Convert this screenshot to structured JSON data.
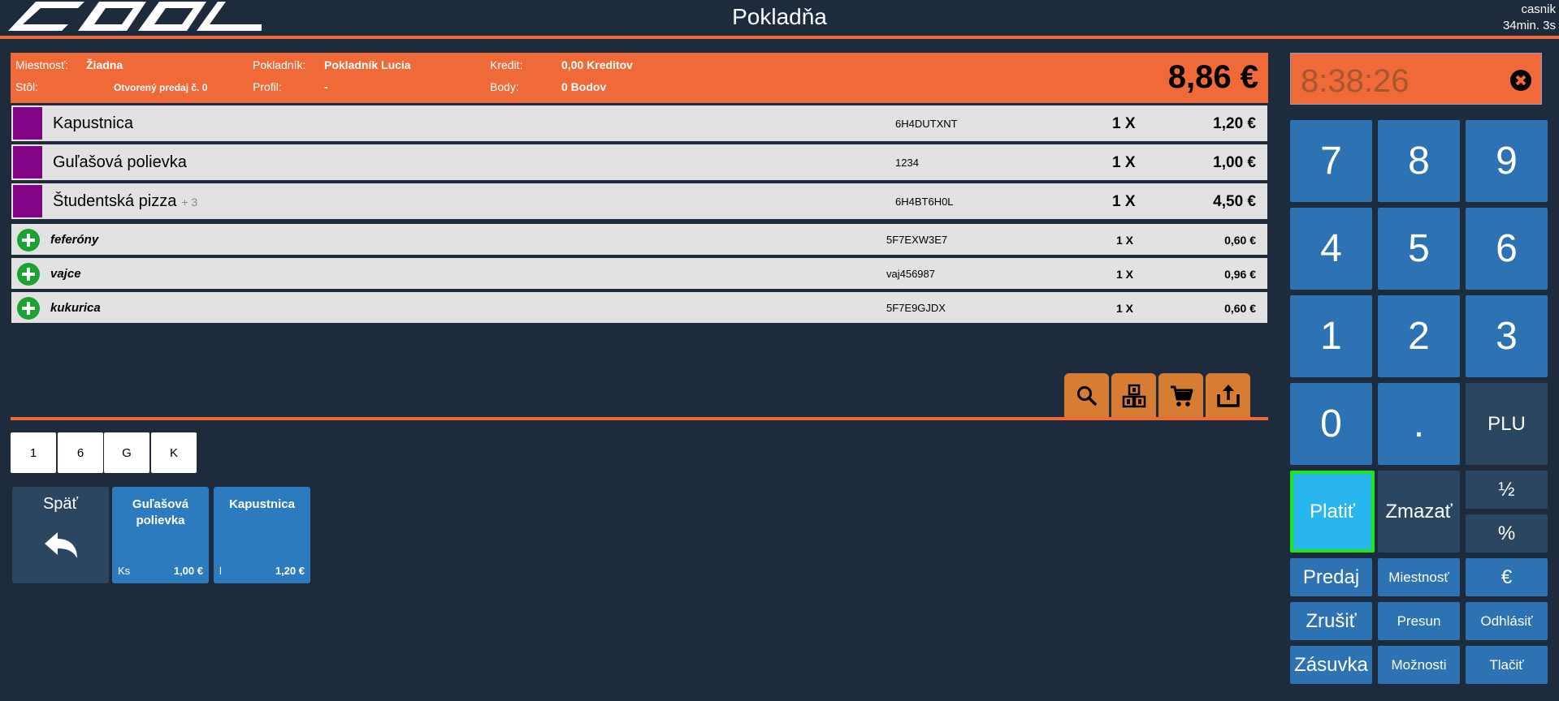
{
  "header": {
    "title": "Pokladňa",
    "user": "casnik",
    "session_time": "34min. 3s"
  },
  "info": {
    "room_label": "Miestnosť:",
    "room_value": "Žiadna",
    "table_label": "Stôl:",
    "table_value": "Otvorený predaj č. 0",
    "cashier_label": "Pokladník:",
    "cashier_value": "Pokladník Lucia",
    "profile_label": "Profil:",
    "profile_value": "-",
    "credit_label": "Kredit:",
    "credit_value": "0,00 Kreditov",
    "points_label": "Body:",
    "points_value": "0 Bodov",
    "total": "8,86 €"
  },
  "order": {
    "items": [
      {
        "name": "Kapustnica",
        "extra": "",
        "code": "6H4DUTXNT",
        "qty": "1 X",
        "price": "1,20 €"
      },
      {
        "name": "Guľašová polievka",
        "extra": "",
        "code": "1234",
        "qty": "1 X",
        "price": "1,00 €"
      },
      {
        "name": "Študentská pizza",
        "extra": "+ 3",
        "code": "6H4BT6H0L",
        "qty": "1 X",
        "price": "4,50 €"
      }
    ],
    "addons": [
      {
        "name": "feferóny",
        "code": "5F7EXW3E7",
        "qty": "1 X",
        "price": "0,60 €"
      },
      {
        "name": "vajce",
        "code": "vaj456987",
        "qty": "1 X",
        "price": "0,96 €"
      },
      {
        "name": "kukurica",
        "code": "5F7E9GJDX",
        "qty": "1 X",
        "price": "0,60 €"
      }
    ]
  },
  "toolbar": {
    "icons": [
      "search-icon",
      "product-codes-icon",
      "cart-icon",
      "export-icon"
    ]
  },
  "filters": [
    "1",
    "6",
    "G",
    "K"
  ],
  "tiles": {
    "back_label": "Späť",
    "products": [
      {
        "name": "Guľašová polievka",
        "unit": "Ks",
        "price": "1,00 €"
      },
      {
        "name": "Kapustnica",
        "unit": "l",
        "price": "1,20 €"
      }
    ]
  },
  "display": {
    "value": "8:38:26"
  },
  "keypad": {
    "k7": "7",
    "k8": "8",
    "k9": "9",
    "k4": "4",
    "k5": "5",
    "k6": "6",
    "k1": "1",
    "k2": "2",
    "k3": "3",
    "k0": "0",
    "dot": ".",
    "plu": "PLU",
    "pay": "Platiť",
    "delete": "Zmazať",
    "half": "½",
    "percent": "%",
    "sale": "Predaj",
    "room": "Miestnosť",
    "euro": "€",
    "cancel": "Zrušiť",
    "move": "Presun",
    "logout": "Odhlásiť",
    "drawer": "Zásuvka",
    "options": "Možnosti",
    "print": "Tlačiť"
  },
  "colors": {
    "background": "#1d2b3d",
    "accent": "#ef6a38",
    "key_blue": "#2d73b3",
    "key_dark": "#2b4661",
    "pay_button": "#29b6ee",
    "pay_border": "#1fe61a",
    "item_marker": "#810586",
    "addon_icon": "#1aa331",
    "tool_button": "#d67c33"
  }
}
